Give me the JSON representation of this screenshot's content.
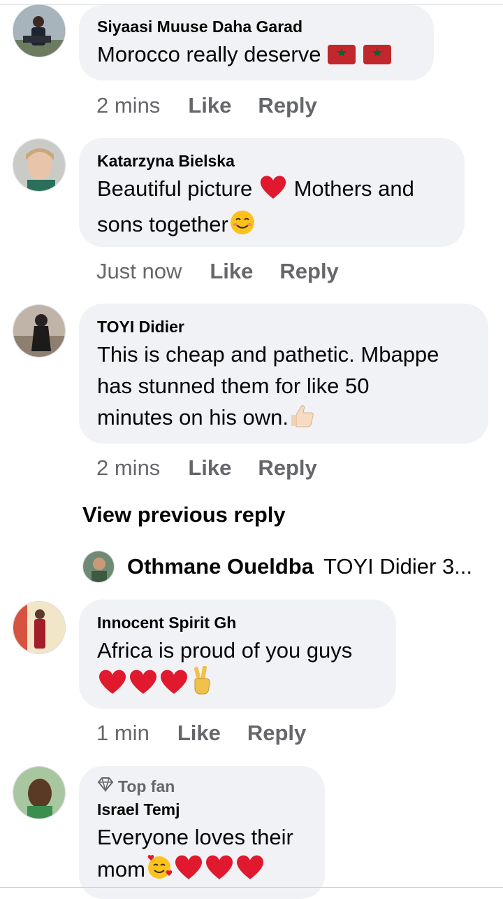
{
  "comments": [
    {
      "name": "Siyaasi Muuse Daha Garad",
      "text": "Morocco really deserve",
      "emojis": [
        "flag-morocco",
        "flag-morocco"
      ],
      "time": "2 mins",
      "like": "Like",
      "reply": "Reply"
    },
    {
      "name": "Katarzyna Bielska",
      "text_line1": "Beautiful picture",
      "text_line1b": "Mothers and",
      "text_line2": "sons together",
      "time": "Just now",
      "like": "Like",
      "reply": "Reply"
    },
    {
      "name": "TOYI Didier",
      "text_line1": "This is cheap and pathetic. Mbappe",
      "text_line2": "has stunned them for like 50",
      "text_line3": "minutes on his own.",
      "time": "2 mins",
      "like": "Like",
      "reply": "Reply"
    },
    {
      "name": "Innocent Spirit Gh",
      "text_line1": "Africa is proud of you guys",
      "time": "1 min",
      "like": "Like",
      "reply": "Reply"
    },
    {
      "badge": "Top fan",
      "name": "Israel Temj",
      "text_line1": "Everyone loves their",
      "text_line2": "mom"
    }
  ],
  "view_previous": "View previous reply",
  "reply_preview": {
    "name": "Othmane Oueldba",
    "text": "TOYI Didier 3..."
  },
  "colors": {
    "bubble": "#f0f2f5",
    "meta": "#65676b",
    "heart": "#e0192e"
  }
}
